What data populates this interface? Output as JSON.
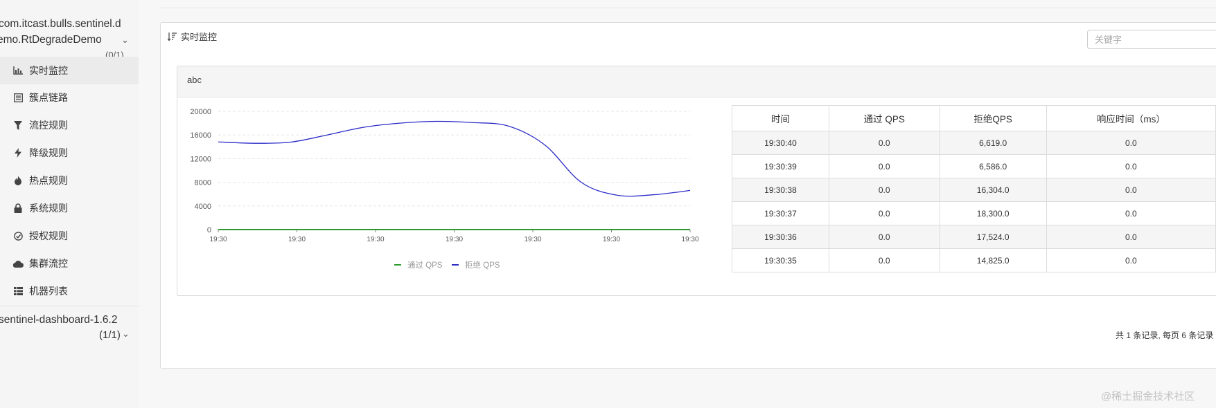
{
  "sidebar": {
    "apps": [
      {
        "name_line1": "com.itcast.bulls.sentinel.d",
        "name_line2": "emo.RtDegradeDemo",
        "count": "(0/1)"
      },
      {
        "name_line1": "sentinel-dashboard-1.6.2",
        "count": "(1/1)"
      }
    ],
    "menu": [
      {
        "label": "实时监控",
        "icon": "bar-chart-icon",
        "active": true
      },
      {
        "label": "簇点链路",
        "icon": "list-icon"
      },
      {
        "label": "流控规则",
        "icon": "filter-icon"
      },
      {
        "label": "降级规则",
        "icon": "flash-icon"
      },
      {
        "label": "热点规则",
        "icon": "fire-icon"
      },
      {
        "label": "系统规则",
        "icon": "lock-icon"
      },
      {
        "label": "授权规则",
        "icon": "check-circle-icon"
      },
      {
        "label": "集群流控",
        "icon": "cloud-icon"
      },
      {
        "label": "机器列表",
        "icon": "grid-icon"
      }
    ]
  },
  "panel": {
    "title": "实时监控",
    "search_placeholder": "关键字"
  },
  "resource": {
    "name": "abc"
  },
  "chart_data": {
    "type": "line",
    "x": [
      "19:30",
      "19:30",
      "19:30",
      "19:30",
      "19:30",
      "19:30",
      "19:30"
    ],
    "y_ticks": [
      0,
      4000,
      8000,
      12000,
      16000,
      20000
    ],
    "ylim": [
      0,
      20000
    ],
    "series": [
      {
        "name": "通过 QPS",
        "color": "#2e9a2e",
        "values": [
          0,
          0,
          0,
          0,
          0,
          0,
          0,
          0,
          0,
          0,
          0,
          0,
          0
        ]
      },
      {
        "name": "拒绝 QPS",
        "color": "#2b2bc8",
        "values": [
          14825,
          14600,
          14800,
          16000,
          17300,
          18000,
          18300,
          18100,
          17500,
          14300,
          8000,
          5800,
          5900,
          6619
        ]
      }
    ],
    "legend": "bottom"
  },
  "table": {
    "columns": [
      "时间",
      "通过 QPS",
      "拒绝QPS",
      "响应时间（ms）"
    ],
    "rows": [
      [
        "19:30:40",
        "0.0",
        "6,619.0",
        "0.0"
      ],
      [
        "19:30:39",
        "0.0",
        "6,586.0",
        "0.0"
      ],
      [
        "19:30:38",
        "0.0",
        "16,304.0",
        "0.0"
      ],
      [
        "19:30:37",
        "0.0",
        "18,300.0",
        "0.0"
      ],
      [
        "19:30:36",
        "0.0",
        "17,524.0",
        "0.0"
      ],
      [
        "19:30:35",
        "0.0",
        "14,825.0",
        "0.0"
      ]
    ]
  },
  "pagination": {
    "text": "共 1 条记录, 每页 6 条记录"
  },
  "watermark": "@稀土掘金技术社区"
}
